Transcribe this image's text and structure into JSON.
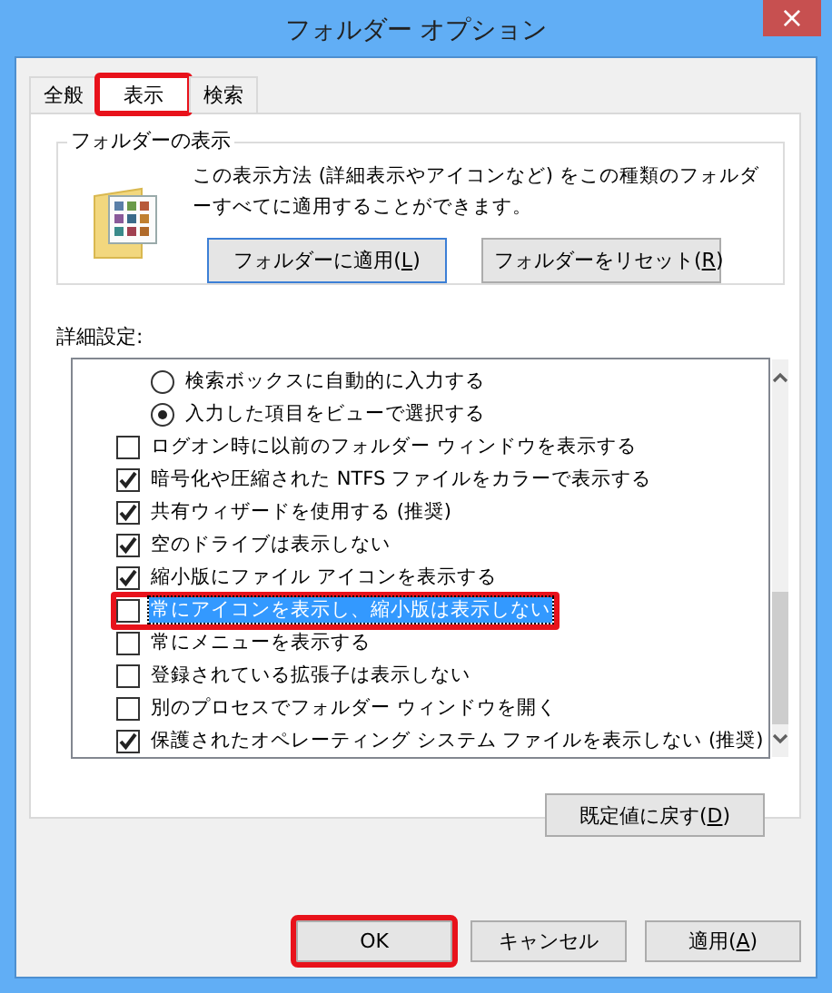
{
  "window": {
    "title": "フォルダー オプション",
    "close": "×"
  },
  "tabs": [
    {
      "label": "全般",
      "selected": false,
      "highlighted": false
    },
    {
      "label": "表示",
      "selected": true,
      "highlighted": true
    },
    {
      "label": "検索",
      "selected": false,
      "highlighted": false
    }
  ],
  "folder_views": {
    "title": "フォルダーの表示",
    "description": "この表示方法 (詳細表示やアイコンなど) をこの種類のフォルダーすべてに適用することができます。",
    "buttons": [
      {
        "before": "フォルダーに適用(",
        "key": "L",
        "after": ")",
        "focused": true
      },
      {
        "before": "フォルダーをリセット(",
        "key": "R",
        "after": ")",
        "focused": false
      }
    ]
  },
  "advanced": {
    "label": "詳細設定:",
    "items": [
      {
        "kind": "radio",
        "label": "検索ボックスに自動的に入力する",
        "checked": false,
        "selected": false,
        "highlighted": false
      },
      {
        "kind": "radio",
        "label": "入力した項目をビューで選択する",
        "checked": true,
        "selected": false,
        "highlighted": false
      },
      {
        "kind": "checkbox",
        "label": "ログオン時に以前のフォルダー ウィンドウを表示する",
        "checked": false,
        "selected": false,
        "highlighted": false
      },
      {
        "kind": "checkbox",
        "label": "暗号化や圧縮された NTFS ファイルをカラーで表示する",
        "checked": true,
        "selected": false,
        "highlighted": false
      },
      {
        "kind": "checkbox",
        "label": "共有ウィザードを使用する (推奨)",
        "checked": true,
        "selected": false,
        "highlighted": false
      },
      {
        "kind": "checkbox",
        "label": "空のドライブは表示しない",
        "checked": true,
        "selected": false,
        "highlighted": false
      },
      {
        "kind": "checkbox",
        "label": "縮小版にファイル アイコンを表示する",
        "checked": true,
        "selected": false,
        "highlighted": false
      },
      {
        "kind": "checkbox",
        "label": "常にアイコンを表示し、縮小版は表示しない",
        "checked": false,
        "selected": true,
        "highlighted": true
      },
      {
        "kind": "checkbox",
        "label": "常にメニューを表示する",
        "checked": false,
        "selected": false,
        "highlighted": false
      },
      {
        "kind": "checkbox",
        "label": "登録されている拡張子は表示しない",
        "checked": false,
        "selected": false,
        "highlighted": false
      },
      {
        "kind": "checkbox",
        "label": "別のプロセスでフォルダー ウィンドウを開く",
        "checked": false,
        "selected": false,
        "highlighted": false
      },
      {
        "kind": "checkbox",
        "label": "保護されたオペレーティング システム ファイルを表示しない (推奨)",
        "checked": true,
        "selected": false,
        "highlighted": false
      }
    ],
    "restore_button": {
      "before": "既定値に戻す(",
      "key": "D",
      "after": ")"
    }
  },
  "footer_buttons": [
    {
      "before": "OK",
      "highlighted": true
    },
    {
      "before": "キャンセル",
      "highlighted": false
    },
    {
      "before": "適用(",
      "key": "A",
      "after": ")",
      "highlighted": false
    }
  ]
}
